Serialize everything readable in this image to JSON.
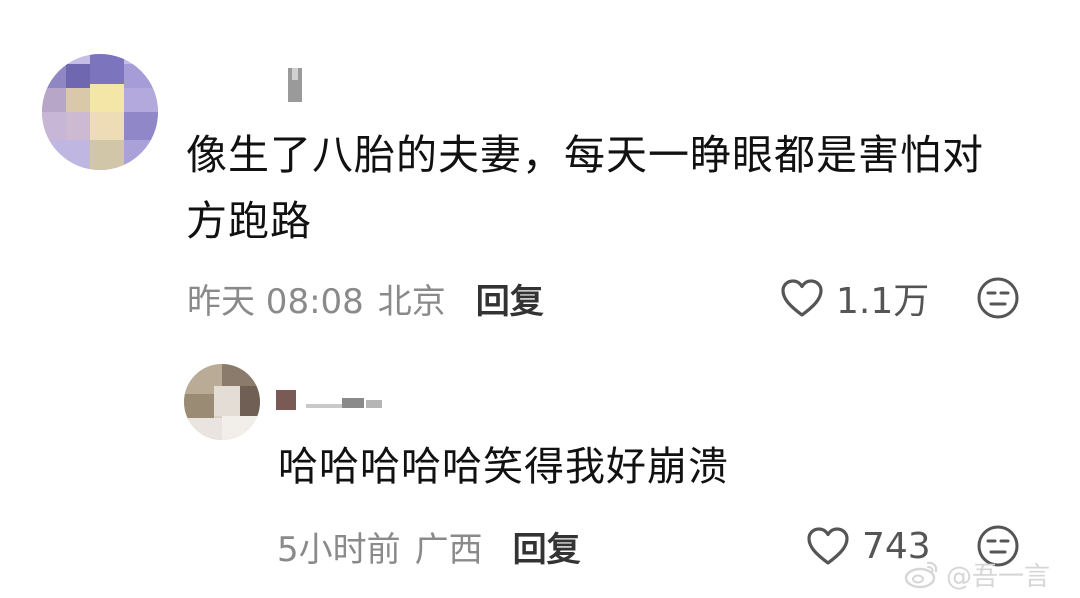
{
  "comments": [
    {
      "content": "像生了八胎的夫妻，每天一睁眼都是害怕对方跑路",
      "time": "昨天 08:08",
      "location": "北京",
      "reply_label": "回复",
      "likes": "1.1万"
    },
    {
      "content": "哈哈哈哈哈笑得我好崩溃",
      "time": "5小时前",
      "location": "广西",
      "reply_label": "回复",
      "likes": "743"
    }
  ],
  "icons": {
    "like": "heart-outline-icon",
    "dislike": "meh-face-icon"
  },
  "watermark": "@吾一言",
  "colors": {
    "text_primary": "#111111",
    "text_secondary": "#8a8a8a",
    "reply_label": "#333333",
    "watermark": "#d6d6d6"
  }
}
